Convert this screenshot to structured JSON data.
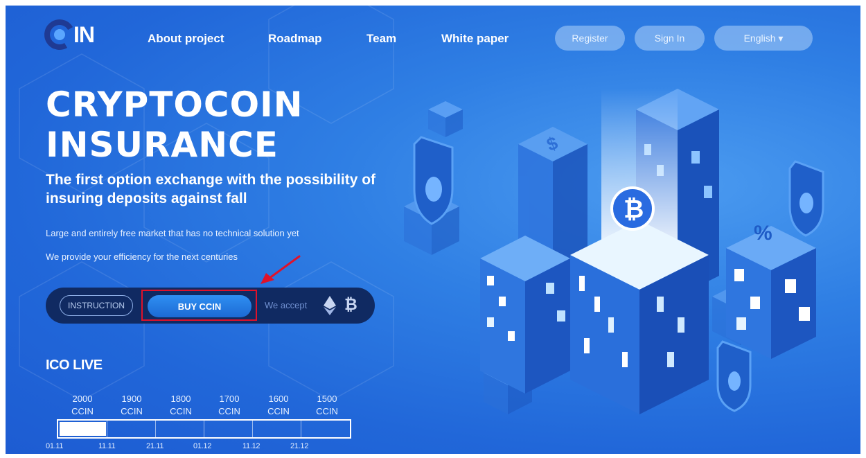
{
  "header": {
    "logo_text": "IN",
    "nav": [
      "About project",
      "Roadmap",
      "Team",
      "White paper"
    ],
    "register_label": "Register",
    "signin_label": "Sign In",
    "language_label": "English ▾"
  },
  "hero": {
    "title_line1": "CRYPTOCOIN",
    "title_line2": "INSURANCE",
    "subtitle": "The first option exchange with the possibility of insuring deposits against fall",
    "para1": "Large and entirely free market that has no technical solution yet",
    "para2": "We provide your efficiency for the next centuries"
  },
  "cta": {
    "instruction_label": "INSTRUCTION",
    "buy_label": "BUY CCIN",
    "accept_label": "We accept",
    "btc_glyph": "₿"
  },
  "ico": {
    "title": "ICO LIVE",
    "tiers": [
      {
        "amount": "2000",
        "unit": "CCIN"
      },
      {
        "amount": "1900",
        "unit": "CCIN"
      },
      {
        "amount": "1800",
        "unit": "CCIN"
      },
      {
        "amount": "1700",
        "unit": "CCIN"
      },
      {
        "amount": "1600",
        "unit": "CCIN"
      },
      {
        "amount": "1500",
        "unit": "CCIN"
      }
    ],
    "dates": [
      "01.11",
      "11.11",
      "21.11",
      "01.12",
      "11.12",
      "21.12"
    ],
    "progress_fraction": 0.16
  },
  "colors": {
    "background": "#2a74e0",
    "cta_bar": "#102a62",
    "buy_button": "#2a85ee",
    "highlight": "#e0122a",
    "logo_ring": "#1f3a93"
  },
  "icons": [
    "bitcoin-icon",
    "ethereum-icon",
    "dollar-icon",
    "percent-icon",
    "shield-icon",
    "arrow-annotation"
  ]
}
